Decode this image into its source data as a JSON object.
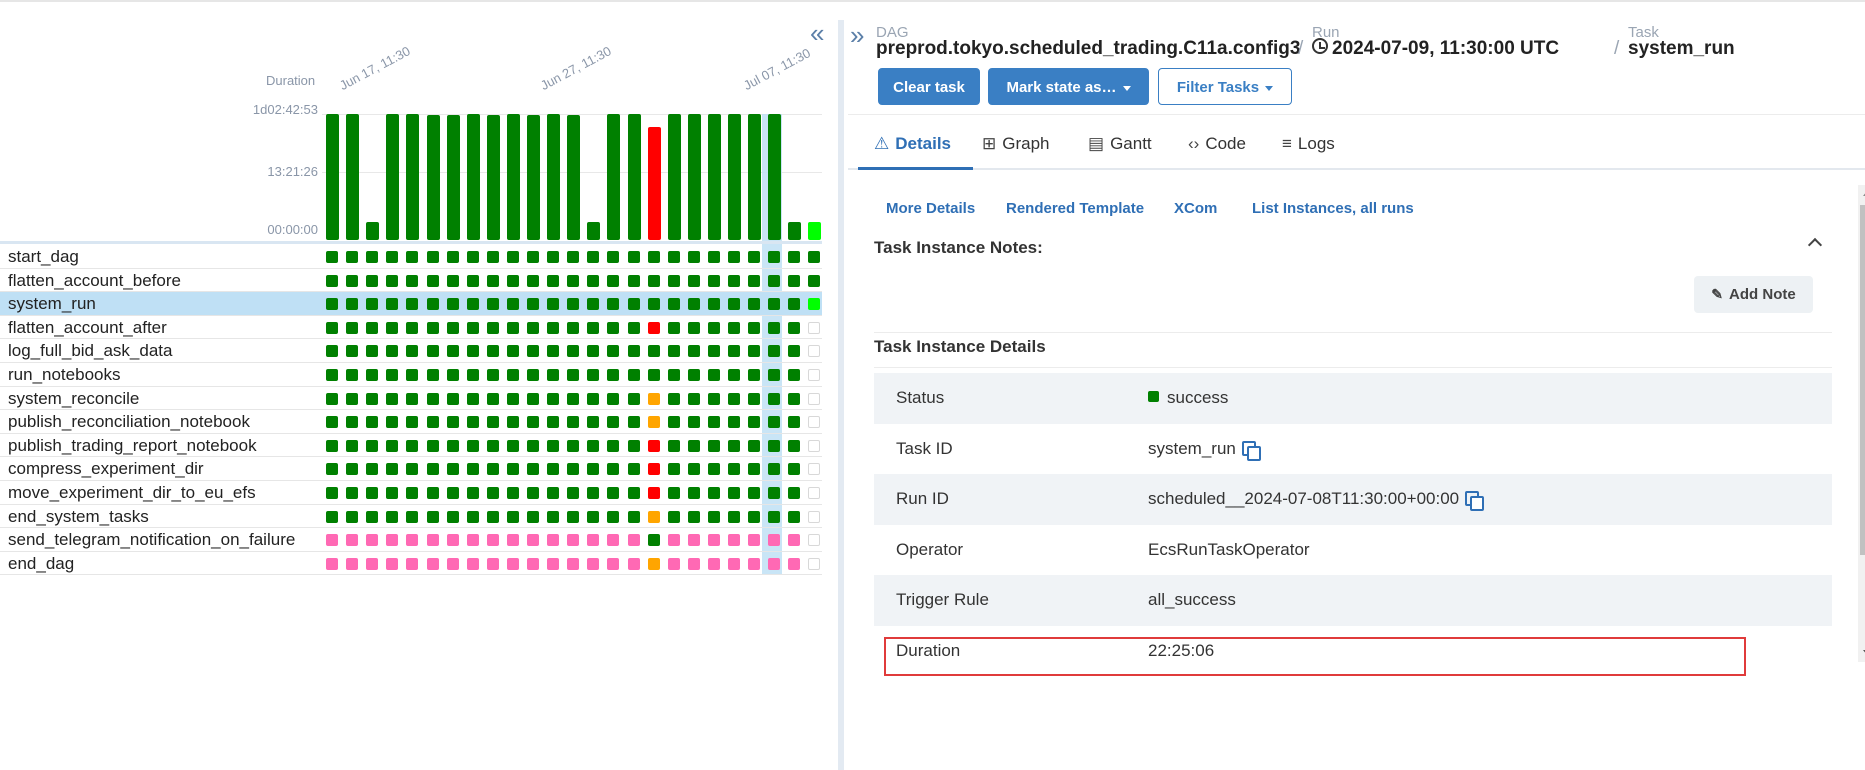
{
  "colors": {
    "success": "#008000",
    "failed": "#ff0000",
    "upstream_failed": "#ffa500",
    "skipped": "#ff69b4",
    "running": "#00ff00",
    "none": "#ffffff",
    "selected": "#bfe0f5",
    "accent": "#3a7fc4"
  },
  "grid": {
    "duration_label": "Duration",
    "y_ticks": [
      "1d02:42:53",
      "13:21:26",
      "00:00:00"
    ],
    "run_dates": [
      "Jun 17, 11:30",
      "Jun 27, 11:30",
      "Jul 07, 11:30"
    ],
    "selected_run_index": 22,
    "run_durations": [
      1,
      1,
      0.14,
      1,
      1,
      0.99,
      0.99,
      1,
      0.99,
      1,
      0.99,
      1,
      0.99,
      0.14,
      1,
      1,
      0.9,
      1,
      1,
      1,
      1,
      1,
      1,
      0.14,
      0.14
    ],
    "run_states": [
      "success",
      "success",
      "success",
      "success",
      "success",
      "success",
      "success",
      "success",
      "success",
      "success",
      "success",
      "success",
      "success",
      "success",
      "success",
      "success",
      "failed",
      "success",
      "success",
      "success",
      "success",
      "success",
      "success",
      "success",
      "running"
    ],
    "tasks": [
      {
        "name": "start_dag",
        "states": "GGGGGGGGGGGGGGGGGGGGGGGGG"
      },
      {
        "name": "flatten_account_before",
        "states": "GGGGGGGGGGGGGGGGGGGGGGGGG"
      },
      {
        "name": "system_run",
        "states": "GGGGGGGGGGGGGGGGGGGGGGGGL"
      },
      {
        "name": "flatten_account_after",
        "states": "GGGGGGGGGGGGGGGGRGGGGGGGN"
      },
      {
        "name": "log_full_bid_ask_data",
        "states": "GGGGGGGGGGGGGGGGGGGGGGGGN"
      },
      {
        "name": "run_notebooks",
        "states": "GGGGGGGGGGGGGGGGGGGGGGGGN"
      },
      {
        "name": "system_reconcile",
        "states": "GGGGGGGGGGGGGGGGOGGGGGGGN"
      },
      {
        "name": "publish_reconciliation_notebook",
        "states": "GGGGGGGGGGGGGGGGOGGGGGGGN"
      },
      {
        "name": "publish_trading_report_notebook",
        "states": "GGGGGGGGGGGGGGGGRGGGGGGGN"
      },
      {
        "name": "compress_experiment_dir",
        "states": "GGGGGGGGGGGGGGGGRGGGGGGGN"
      },
      {
        "name": "move_experiment_dir_to_eu_efs",
        "states": "GGGGGGGGGGGGGGGGRGGGGGGGN"
      },
      {
        "name": "end_system_tasks",
        "states": "GGGGGGGGGGGGGGGGOGGGGGGGN"
      },
      {
        "name": "send_telegram_notification_on_failure",
        "states": "PPPPPPPPPPPPPPPPGPPPPPPPN"
      },
      {
        "name": "end_dag",
        "states": "PPPPPPPPPPPPPPPPOPPPPPPPN"
      }
    ],
    "selected_task": "system_run"
  },
  "header": {
    "dag_label": "DAG",
    "dag_id": "preprod.tokyo.scheduled_trading.C11a.config3",
    "run_label": "Run",
    "run_value": "2024-07-09, 11:30:00 UTC",
    "task_label": "Task",
    "task_value": "system_run",
    "separator": "/"
  },
  "actions": {
    "clear_task": "Clear task",
    "mark_state": "Mark state as…",
    "filter_tasks": "Filter Tasks"
  },
  "tabs": [
    {
      "label": "Details",
      "icon": "warning-triangle-icon",
      "glyph": "⚠"
    },
    {
      "label": "Graph",
      "icon": "graph-icon",
      "glyph": "⊞"
    },
    {
      "label": "Gantt",
      "icon": "gantt-icon",
      "glyph": "▤"
    },
    {
      "label": "Code",
      "icon": "code-icon",
      "glyph": "‹›"
    },
    {
      "label": "Logs",
      "icon": "logs-icon",
      "glyph": "≡"
    }
  ],
  "sub_links": [
    "More Details",
    "Rendered Template",
    "XCom",
    "List Instances, all runs"
  ],
  "notes": {
    "title": "Task Instance Notes:",
    "add_note": "Add Note"
  },
  "details": {
    "title": "Task Instance Details",
    "rows": [
      {
        "key": "Status",
        "value": "success"
      },
      {
        "key": "Task ID",
        "value": "system_run"
      },
      {
        "key": "Run ID",
        "value": "scheduled__2024-07-08T11:30:00+00:00"
      },
      {
        "key": "Operator",
        "value": "EcsRunTaskOperator"
      },
      {
        "key": "Trigger Rule",
        "value": "all_success"
      },
      {
        "key": "Duration",
        "value": "22:25:06"
      }
    ]
  }
}
